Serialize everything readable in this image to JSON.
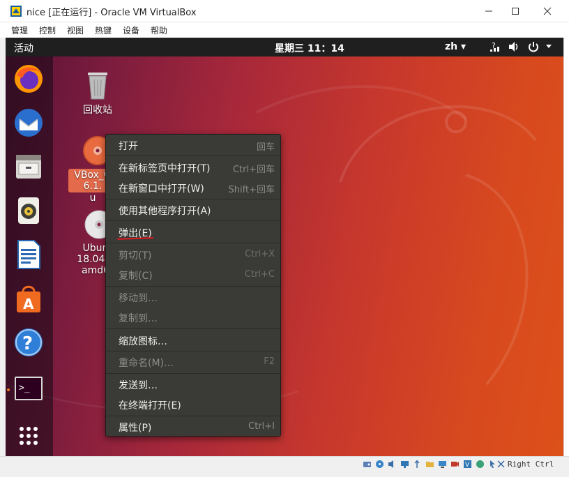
{
  "window": {
    "title": "nice [正在运行] - Oracle VM VirtualBox",
    "menus": [
      "管理",
      "控制",
      "视图",
      "热键",
      "设备",
      "帮助"
    ]
  },
  "topbar": {
    "activities": "活动",
    "clock": "星期三 11：14",
    "lang": "zh ▾"
  },
  "desktop": {
    "trash_label": "回收站",
    "vbox_label_lines": [
      "VBox_G",
      "6.1.",
      "u"
    ],
    "ubuntu_label_lines": [
      "Ubun",
      "18.04.4",
      "amd6"
    ]
  },
  "dock": {
    "items": [
      "firefox-icon",
      "thunderbird-icon",
      "files-icon",
      "rhythmbox-icon",
      "libreoffice-writer-icon",
      "software-center-icon",
      "help-icon",
      "terminal-icon",
      "show-apps-icon"
    ]
  },
  "context_menu": {
    "items": [
      {
        "label": "打开",
        "accel": "回车",
        "enabled": true
      },
      {
        "label": "在新标签页中打开(T)",
        "accel": "Ctrl+回车",
        "enabled": true
      },
      {
        "label": "在新窗口中打开(W)",
        "accel": "Shift+回车",
        "enabled": true
      },
      {
        "label": "使用其他程序打开(A)",
        "accel": "",
        "enabled": true
      },
      {
        "label": "弹出(E)",
        "accel": "",
        "enabled": true
      },
      {
        "label": "剪切(T)",
        "accel": "Ctrl+X",
        "enabled": false
      },
      {
        "label": "复制(C)",
        "accel": "Ctrl+C",
        "enabled": false
      },
      {
        "label": "移动到…",
        "accel": "",
        "enabled": false
      },
      {
        "label": "复制到…",
        "accel": "",
        "enabled": false
      },
      {
        "label": "缩放图标…",
        "accel": "",
        "enabled": true
      },
      {
        "label": "重命名(M)…",
        "accel": "F2",
        "enabled": false
      },
      {
        "label": "发送到…",
        "accel": "",
        "enabled": true
      },
      {
        "label": "在终端打开(E)",
        "accel": "",
        "enabled": true
      },
      {
        "label": "属性(P)",
        "accel": "Ctrl+I",
        "enabled": true
      }
    ]
  },
  "statusbar": {
    "host_key": "Right Ctrl"
  },
  "colors": {
    "accent": "#f47421",
    "menu_bg": "#3a3a37",
    "annotation_red": "#e0181e"
  }
}
